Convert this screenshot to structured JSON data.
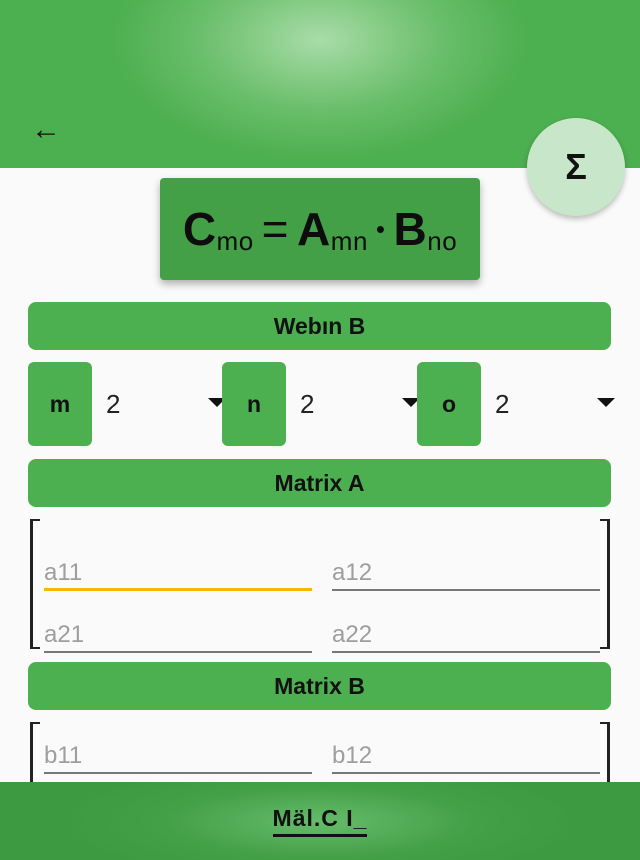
{
  "appbar": {
    "back_icon": "arrow-left-icon",
    "fab_symbol": "Σ"
  },
  "formula": {
    "c": "C",
    "c_sub": "mo",
    "eq": "=",
    "a": "A",
    "a_sub": "mn",
    "dot": "•",
    "b": "B",
    "b_sub": "no"
  },
  "sections": {
    "dims_title": "Webın B",
    "matrix_a_title": "Matrix A",
    "matrix_b_title": "Matrix B"
  },
  "dims": [
    {
      "label": "m",
      "value": "2"
    },
    {
      "label": "n",
      "value": "2"
    },
    {
      "label": "o",
      "value": "2"
    }
  ],
  "matrix_a": {
    "placeholders": [
      "a11",
      "a12",
      "a21",
      "a22"
    ]
  },
  "matrix_b": {
    "placeholders": [
      "b11",
      "b12"
    ]
  },
  "bottom": {
    "label": "Mäl.C I_"
  },
  "colors": {
    "primary": "#4caf50",
    "accent": "#f5b800",
    "fab": "#c8e6c9"
  }
}
